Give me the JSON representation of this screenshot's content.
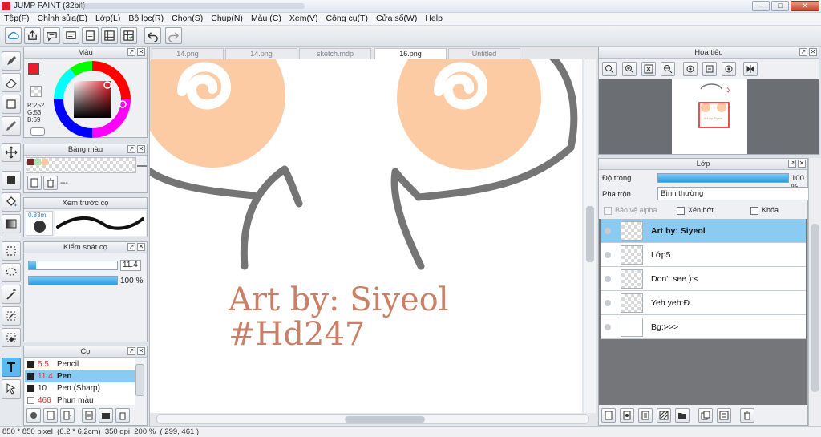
{
  "window": {
    "title": "JUMP PAINT (32bit)",
    "minimize": "–",
    "maximize": "□",
    "close": "✕"
  },
  "menu": [
    "Tệp(F)",
    "Chỉnh sửa(E)",
    "Lớp(L)",
    "Bộ lọc(R)",
    "Chọn(S)",
    "Chụp(N)",
    "Màu (C)",
    "Xem(V)",
    "Công cụ(T)",
    "Cửa sổ(W)",
    "Help"
  ],
  "toolbar": {
    "icons": [
      "cloud-icon",
      "export-icon",
      "speech-icon",
      "comment-icon",
      "page-icon",
      "page-grid-icon",
      "layout-check-icon"
    ],
    "history_icons": [
      "undo-icon",
      "redo-icon"
    ]
  },
  "tools": [
    "pen-tool-icon",
    "eraser-tool-icon",
    "select-rect-icon",
    "brush-tool-icon",
    "move-tool-icon",
    "fill-shape-icon",
    "bucket-tool-icon",
    "gradient-tool-icon",
    "marquee-tool-icon",
    "lasso-tool-icon",
    "magic-wand-icon",
    "ruler-tool-icon",
    "eraser-sel-icon",
    "text-tool-icon",
    "lasso-pick-icon"
  ],
  "color_panel": {
    "title": "Màu",
    "primary_color": "#ee1c2a",
    "secondary_color": "#fbcaa2",
    "r": "R:252",
    "g": "G:53",
    "b": "B:69"
  },
  "swatch_panel": {
    "title": "Bảng màu",
    "swatches": [
      "#7a2a25",
      "#b7e3b2",
      "#fbcaa2"
    ],
    "label": "---"
  },
  "preview_panel": {
    "title": "Xem trước cọ",
    "size": "0.83m"
  },
  "brush_control": {
    "title": "Kiểm soát cọ",
    "size_value": "11.4",
    "size_fill": 0.08,
    "opacity_value": "100 %",
    "opacity_fill": 1.0
  },
  "brush_panel": {
    "title": "Cọ",
    "items": [
      {
        "size": "5.5",
        "name": "Pencil",
        "selected": false
      },
      {
        "size": "11.4",
        "name": "Pen",
        "selected": true
      },
      {
        "size": "10",
        "name": "Pen (Sharp)",
        "selected": false
      },
      {
        "size": "466",
        "name": "Phun màu",
        "selected": false
      }
    ]
  },
  "tabs": [
    "14.png",
    "14.png",
    "sketch.mdp",
    "16.png",
    "Untitled"
  ],
  "canvas": {
    "text_line1": "Art by: Siyeol",
    "text_line2": "#Hd247",
    "text_color": "#c98066",
    "blush_color": "#fccba4"
  },
  "navigator": {
    "title": "Hoa tiêu",
    "icons": [
      "zoom-fit-icon",
      "zoom-in-icon",
      "zoom-actual-icon",
      "zoom-out-icon",
      "rotate-left-icon",
      "rotate-reset-icon",
      "rotate-right-icon",
      "flip-icon"
    ]
  },
  "layers": {
    "title": "Lớp",
    "opacity_label": "Độ trong",
    "opacity_value": "100 %",
    "opacity_fill": 1.0,
    "blend_label": "Pha trộn",
    "blend_value": "Bình thường",
    "protect_alpha": "Bảo vệ alpha",
    "clipping": "Xén bớt",
    "lock": "Khóa",
    "items": [
      {
        "name": "Art by: Siyeol",
        "active": true
      },
      {
        "name": "Lớp5",
        "active": false
      },
      {
        "name": "Don't see ):<",
        "active": false
      },
      {
        "name": "Yeh yeh:Đ",
        "active": false
      },
      {
        "name": "Bg:>>>",
        "active": false
      }
    ],
    "bottom_icons": [
      "new-layer-icon",
      "new-raster-icon",
      "copy-layer-icon",
      "halftone-layer-icon",
      "folder-icon",
      "duplicate-icon",
      "merge-icon",
      "trash-icon"
    ]
  },
  "status": {
    "size": "850 * 850 pixel",
    "cm": "(6.2 * 6.2cm)",
    "dpi": "350 dpi",
    "zoom": "200 %",
    "coords": "( 299, 461 )"
  }
}
